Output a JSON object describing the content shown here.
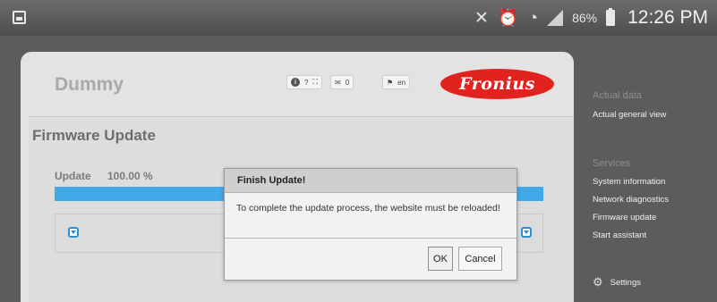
{
  "statusbar": {
    "battery_percent": "86%",
    "time": "12:26 PM",
    "icons": [
      "gallery-icon",
      "mute-icon",
      "alarm-icon",
      "wifi-icon",
      "signal-icon",
      "battery-icon"
    ]
  },
  "header": {
    "device_name": "Dummy",
    "help_label": "?",
    "messages_count": "0",
    "language": "en",
    "logo_text": "Fronius"
  },
  "page": {
    "title": "Firmware Update",
    "update_label": "Update",
    "update_value": "100.00 %",
    "progress": 1.0
  },
  "modal": {
    "title": "Finish Update!",
    "message": "To complete the update process, the website must be reloaded!",
    "ok_label": "OK",
    "cancel_label": "Cancel"
  },
  "menu": {
    "actual_data_title": "Actual data",
    "actual_general_view": "Actual general view",
    "services_title": "Services",
    "items": [
      "System information",
      "Network diagnostics",
      "Firmware update",
      "Start assistant"
    ],
    "settings_label": "Settings"
  },
  "colors": {
    "accent_blue": "#42a9e8",
    "fronius_red": "#e2221f"
  }
}
